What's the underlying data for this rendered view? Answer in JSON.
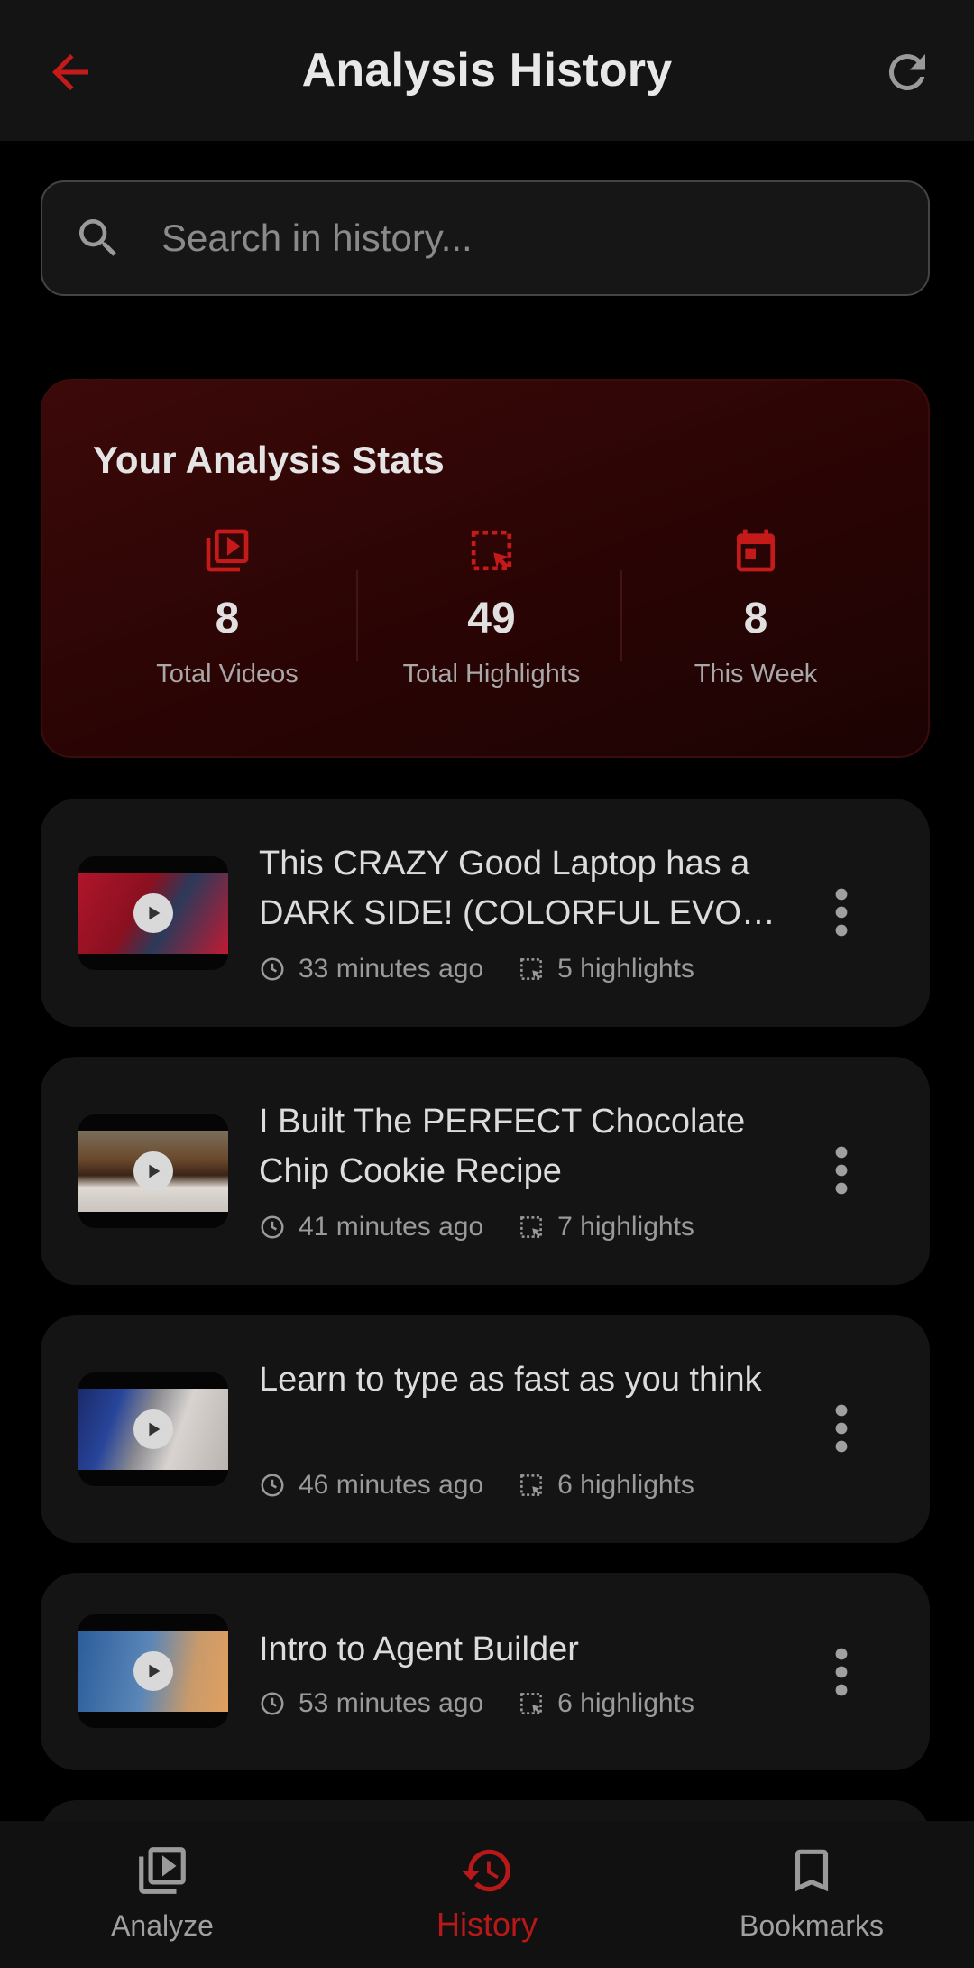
{
  "app_bar": {
    "title": "Analysis History",
    "back_icon": "arrow-back-icon",
    "refresh_icon": "refresh-icon",
    "accent": "#b81818"
  },
  "search": {
    "placeholder": "Search in history...",
    "value": ""
  },
  "stats": {
    "title": "Your Analysis Stats",
    "items": [
      {
        "value": "8",
        "label": "Total Videos",
        "icon": "video-library-icon"
      },
      {
        "value": "49",
        "label": "Total Highlights",
        "icon": "highlight-select-icon"
      },
      {
        "value": "8",
        "label": "This Week",
        "icon": "calendar-icon"
      }
    ]
  },
  "history": [
    {
      "title": "This CRAZY Good Laptop has a DARK SIDE! (COLORFUL EVOL …",
      "time": "33 minutes ago",
      "highlights": "5 highlights"
    },
    {
      "title": "I Built The PERFECT Chocolate Chip Cookie Recipe",
      "time": "41 minutes ago",
      "highlights": "7 highlights"
    },
    {
      "title": "Learn to type as fast as you think",
      "time": "46 minutes ago",
      "highlights": "6 highlights"
    },
    {
      "title": "Intro to Agent Builder",
      "time": "53 minutes ago",
      "highlights": "6 highlights"
    }
  ],
  "bottom_nav": [
    {
      "label": "Analyze",
      "icon": "video-library-icon",
      "active": false
    },
    {
      "label": "History",
      "icon": "history-icon",
      "active": true
    },
    {
      "label": "Bookmarks",
      "icon": "bookmark-icon",
      "active": false
    }
  ]
}
